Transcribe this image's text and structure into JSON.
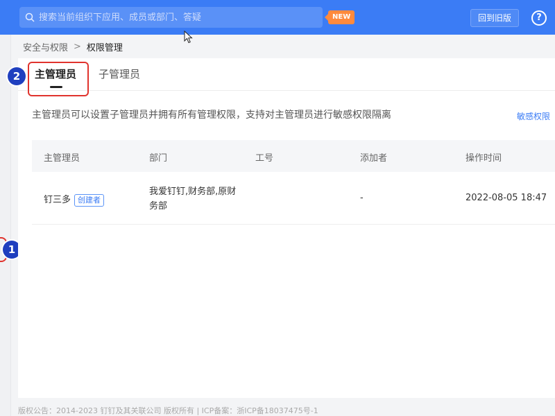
{
  "topbar": {
    "search_placeholder": "搜索当前组织下应用、成员或部门、答疑",
    "new_badge": "NEW",
    "old_version_button": "回到旧版",
    "help_icon": "?"
  },
  "breadcrumb": {
    "parent": "安全与权限",
    "separator": ">",
    "current": "权限管理"
  },
  "tabs": {
    "main_admin": "主管理员",
    "sub_admin": "子管理员"
  },
  "description": "主管理员可以设置子管理员并拥有所有管理权限，支持对主管理员进行敏感权限隔离",
  "sensitive_link": "敏感权限",
  "table": {
    "headers": [
      "主管理员",
      "部门",
      "工号",
      "添加者",
      "操作时间"
    ],
    "rows": [
      {
        "name": "钉三多",
        "badge": "创建者",
        "department": "我爱钉钉,财务部,原财务部",
        "employee_id": "",
        "added_by": "-",
        "time": "2022-08-05 18:47"
      }
    ]
  },
  "markers": {
    "one": "1",
    "two": "2"
  },
  "footer": "版权公告：2014-2023 钉钉及其关联公司 版权所有 | ICP备案：浙ICP备18037475号-1",
  "colors": {
    "topbar": "#3b7cf5",
    "highlight": "#e0332d",
    "marker": "#1f3fbf",
    "link": "#3b7cf5"
  }
}
